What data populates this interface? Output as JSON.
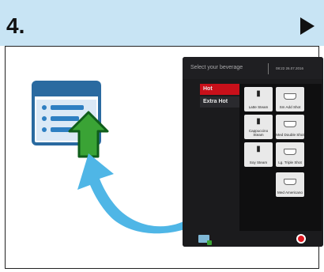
{
  "step": {
    "number": "4."
  },
  "screen": {
    "title": "Select your beverage",
    "datetime": "08:22   26.07.2016",
    "categories": [
      {
        "label": "Hot",
        "active": true
      },
      {
        "label": "Extra Hot",
        "active": false
      }
    ],
    "beverages": [
      {
        "label": "Latte Steam"
      },
      {
        "label": "Sm Add Shot"
      },
      {
        "label": "Cappuccino Steam"
      },
      {
        "label": "Med Double Shot"
      },
      {
        "label": "Soy Steam"
      },
      {
        "label": "Lg. Triple Shot"
      },
      {
        "label": "Med Americano"
      }
    ]
  },
  "colors": {
    "header_bg": "#c8e4f4",
    "arrow_blue": "#4fb6e6",
    "upload_green": "#3aa335",
    "active_red": "#c8101a"
  }
}
